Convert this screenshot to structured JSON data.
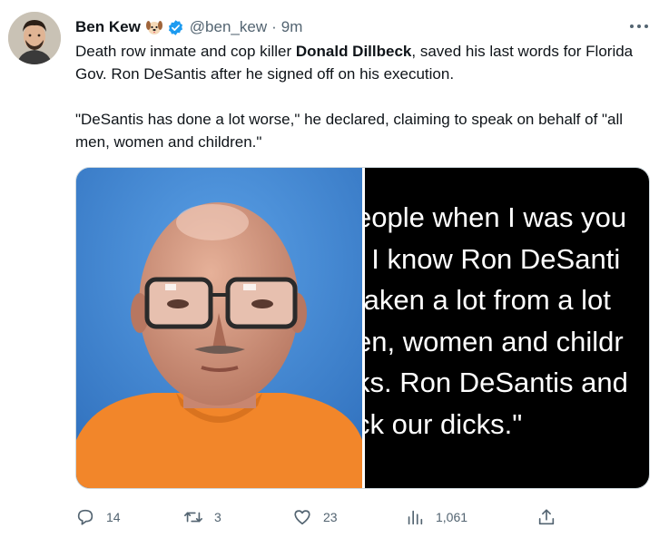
{
  "author": {
    "display_name": "Ben Kew",
    "emoji_icon": "dog-face-icon",
    "verified_icon": "verified-badge-icon",
    "handle": "@ben_kew",
    "separator": "·",
    "time": "9m"
  },
  "tweet": {
    "p1_before": "Death row inmate and cop killer ",
    "p1_bold": "Donald Dillbeck",
    "p1_after": ", saved his last words for Florida Gov. Ron DeSantis after he signed off on his execution.",
    "p2": "\"DeSantis has done a lot worse,\" he declared, claiming to speak on behalf of \"all men, women and children.\""
  },
  "media": {
    "quote_lines": [
      "eople when I was you",
      "t I know Ron DeSanti",
      "taken a lot from a lot",
      "en, women and childr",
      "ks. Ron DeSantis and",
      "ck our dicks.\""
    ]
  },
  "actions": {
    "reply_count": "14",
    "retweet_count": "3",
    "like_count": "23",
    "views_count": "1,061"
  },
  "colors": {
    "text": "#0f1419",
    "muted": "#536471",
    "verified_blue": "#1d9bf0",
    "photo_bg": "#3f86d4",
    "shirt_orange": "#f2862a"
  }
}
